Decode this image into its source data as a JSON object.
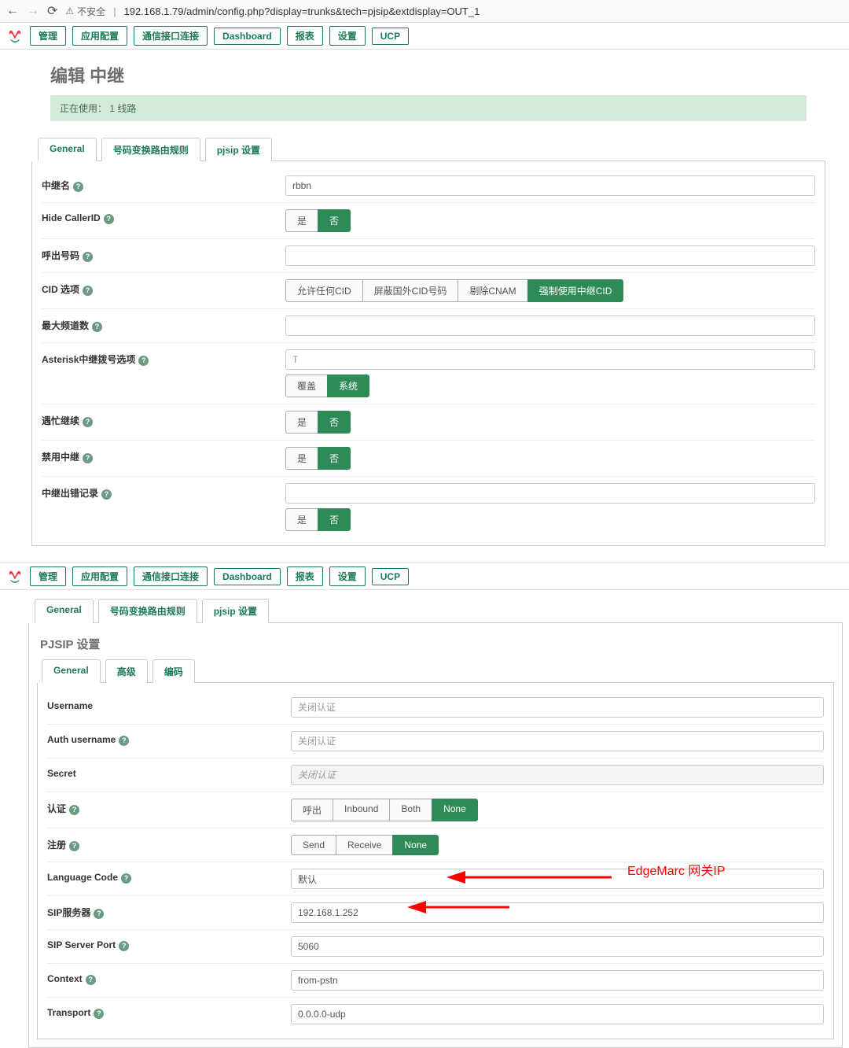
{
  "browser": {
    "insecure_label": "不安全",
    "url": "192.168.1.79/admin/config.php?display=trunks&tech=pjsip&extdisplay=OUT_1"
  },
  "nav": {
    "items": [
      "管理",
      "应用配置",
      "通信接口连接",
      "Dashboard",
      "报表",
      "设置",
      "UCP"
    ]
  },
  "page": {
    "title": "编辑 中继",
    "in_use": "正在使用： 1 线路"
  },
  "tabs_main": [
    "General",
    "号码变换路由规则",
    "pjsip 设置"
  ],
  "general": {
    "rows": {
      "trunk_name": {
        "label": "中继名",
        "value": "rbbn"
      },
      "hide_cid": {
        "label": "Hide CallerID",
        "yes": "是",
        "no": "否",
        "active": "no"
      },
      "out_cid": {
        "label": "呼出号码",
        "value": ""
      },
      "cid_options": {
        "label": "CID 选项",
        "opts": [
          "允许任何CID",
          "屏蔽国外CID号码",
          "剔除CNAM",
          "强制使用中继CID"
        ],
        "active": 3
      },
      "max_channels": {
        "label": "最大频道数",
        "value": ""
      },
      "dial_opts": {
        "label": "Asterisk中继拨号选项",
        "placeholder": "T",
        "override": "覆盖",
        "system": "系统",
        "active": "system"
      },
      "continue_busy": {
        "label": "遇忙继续",
        "yes": "是",
        "no": "否",
        "active": "no"
      },
      "disable_trunk": {
        "label": "禁用中继",
        "yes": "是",
        "no": "否",
        "active": "no"
      },
      "err_record": {
        "label": "中继出错记录",
        "value": ""
      },
      "err_toggle": {
        "yes": "是",
        "no": "否",
        "active": "no"
      }
    }
  },
  "tabs_lower": [
    "General",
    "号码变换路由规则",
    "pjsip 设置"
  ],
  "pjsip": {
    "heading": "PJSIP 设置",
    "tabs": [
      "General",
      "高级",
      "编码"
    ],
    "rows": {
      "username": {
        "label": "Username",
        "placeholder": "关闭认证"
      },
      "auth_username": {
        "label": "Auth username",
        "placeholder": "关闭认证"
      },
      "secret": {
        "label": "Secret",
        "placeholder": "关闭认证"
      },
      "auth": {
        "label": "认证",
        "opts": [
          "呼出",
          "Inbound",
          "Both",
          "None"
        ],
        "active": 3
      },
      "register": {
        "label": "注册",
        "opts": [
          "Send",
          "Receive",
          "None"
        ],
        "active": 2
      },
      "lang": {
        "label": "Language Code",
        "value": "默认"
      },
      "sip_server": {
        "label": "SIP服务器",
        "value": "192.168.1.252"
      },
      "sip_port": {
        "label": "SIP Server Port",
        "value": "5060"
      },
      "context": {
        "label": "Context",
        "value": "from-pstn"
      },
      "transport": {
        "label": "Transport",
        "value": "0.0.0.0-udp"
      }
    },
    "annotation": "EdgeMarc 网关IP"
  }
}
